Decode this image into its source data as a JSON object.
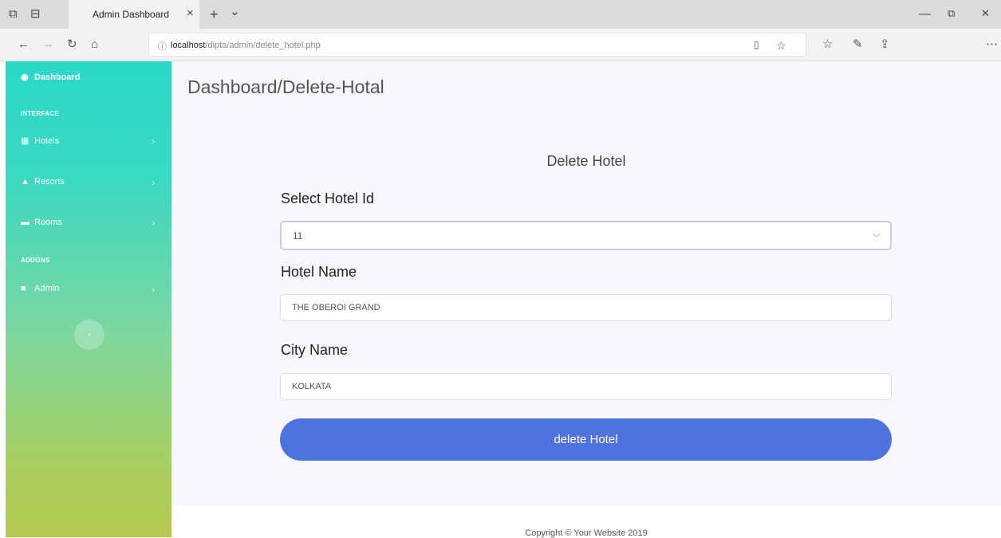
{
  "browser": {
    "tab_title": "Admin Dashboard",
    "tab_close": "×",
    "new_tab": "+",
    "tab_menu": "⌄",
    "url_host": "localhost",
    "url_path": "/dipta/admin/delete_hotel.php",
    "win_min": "—",
    "win_max": "⧉",
    "win_close": "✕"
  },
  "sidebar": {
    "brand": "Dashboard",
    "section_interface": "INTERFACE",
    "section_addons": "ADDONS",
    "items": [
      {
        "label": "Hotels"
      },
      {
        "label": "Resorts"
      },
      {
        "label": "Rooms"
      },
      {
        "label": "Admin"
      }
    ],
    "toggle": "‹"
  },
  "main": {
    "breadcrumb": "Dashboard/Delete-Hotal",
    "card_title": "Delete Hotel",
    "hotel_id_label": "Select Hotel Id",
    "hotel_id_value": "11",
    "hotel_name_label": "Hotel Name",
    "hotel_name_value": "THE OBEROI GRAND",
    "city_label": "City Name",
    "city_value": "KOLKATA",
    "submit_label": "delete Hotel",
    "footer": "Copyright © Your Website 2019"
  },
  "colors": {
    "accent": "#4e73df",
    "sidebar_top": "#2ad8c9",
    "sidebar_bottom": "#b5c94f"
  }
}
